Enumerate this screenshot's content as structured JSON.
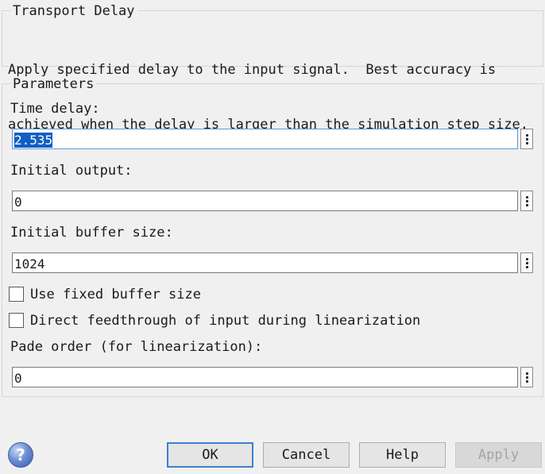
{
  "block": {
    "title": "Transport Delay",
    "description_line1": "Apply specified delay to the input signal.  Best accuracy is",
    "description_line2": "achieved when the delay is larger than the simulation step size."
  },
  "parameters": {
    "title": "Parameters",
    "time_delay": {
      "label": "Time delay:",
      "value": "2.535"
    },
    "initial_output": {
      "label": "Initial output:",
      "value": "0"
    },
    "initial_buffer_size": {
      "label": "Initial buffer size:",
      "value": "1024"
    },
    "use_fixed_buffer": {
      "label": "Use fixed buffer size",
      "checked": false
    },
    "direct_feedthrough": {
      "label": "Direct feedthrough of input during linearization",
      "checked": false
    },
    "pade_order": {
      "label": "Pade order (for linearization):",
      "value": "0"
    }
  },
  "buttons": {
    "help_icon": "?",
    "ok": "OK",
    "cancel": "Cancel",
    "help": "Help",
    "apply": "Apply"
  }
}
